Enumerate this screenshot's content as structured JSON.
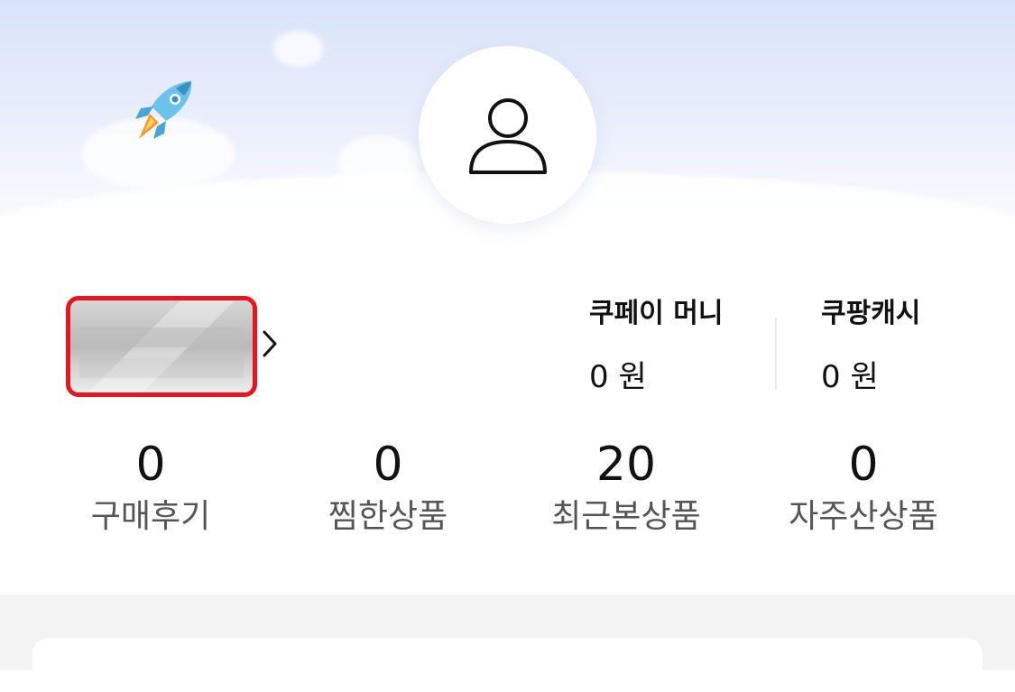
{
  "wallets": [
    {
      "title": "쿠페이 머니",
      "value": "0 원"
    },
    {
      "title": "쿠팡캐시",
      "value": "0 원"
    }
  ],
  "stats": [
    {
      "count": "0",
      "label": "구매후기"
    },
    {
      "count": "0",
      "label": "찜한상품"
    },
    {
      "count": "20",
      "label": "최근본상품"
    },
    {
      "count": "0",
      "label": "자주산상품"
    }
  ],
  "icons": {
    "profile": "user-icon",
    "decoration": "rocket-icon",
    "name_arrow": "chevron-right-icon"
  },
  "colors": {
    "highlight_border": "#e8151e",
    "hero_top": "#d9e3fa"
  }
}
